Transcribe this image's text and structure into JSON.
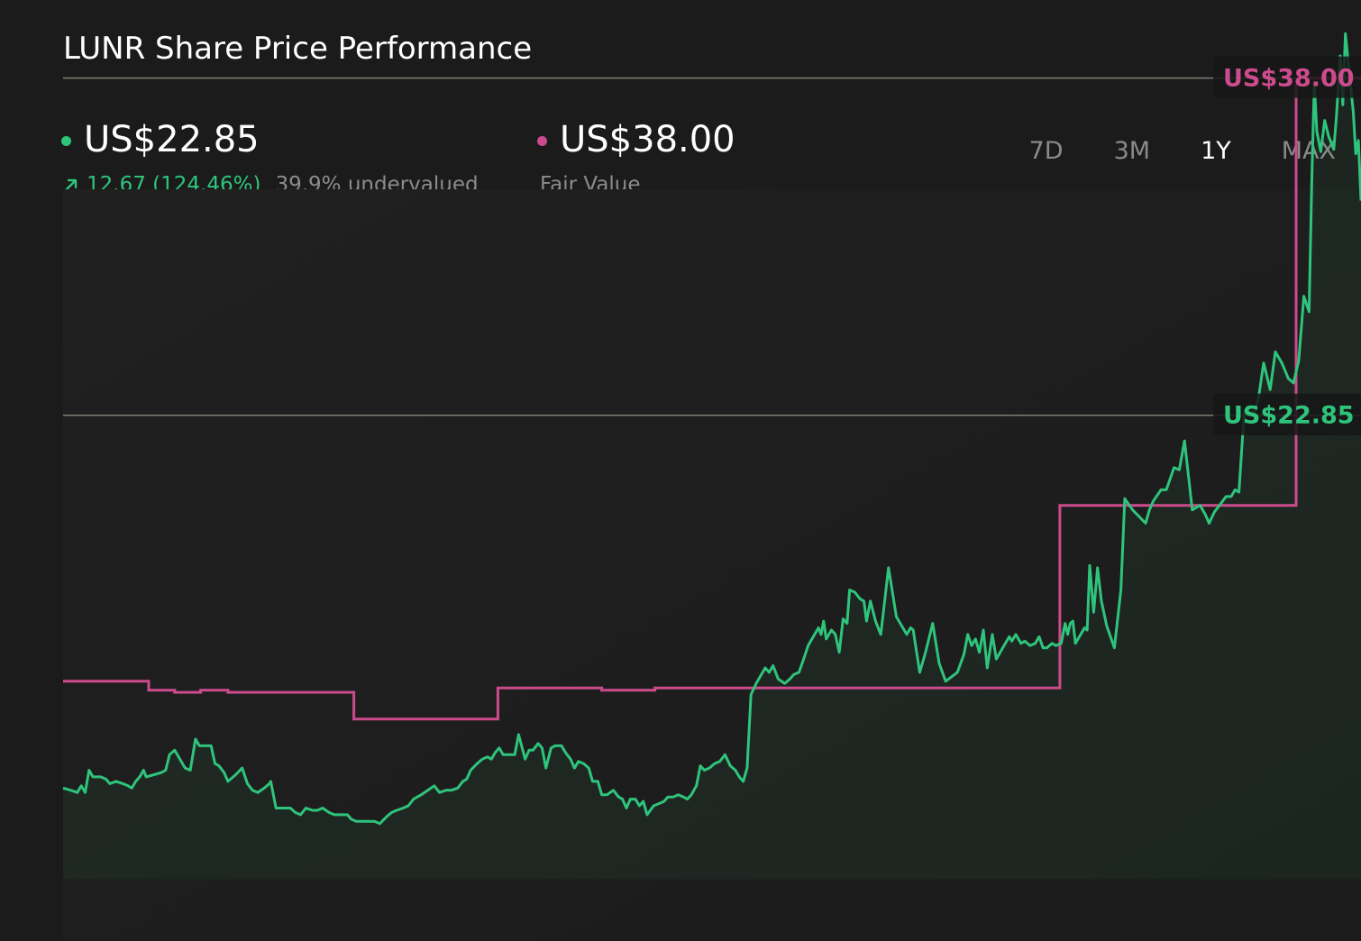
{
  "title": "LUNR Share Price Performance",
  "legend": {
    "price": {
      "value": "US$22.85",
      "color": "#2fc47c",
      "change": "12.67 (124.46%)",
      "note": "39.9% undervalued",
      "change_icon": "arrow-up-right-icon"
    },
    "fair": {
      "value": "US$38.00",
      "color": "#cc4b8c",
      "label": "Fair Value"
    }
  },
  "tabs": [
    {
      "label": "7D",
      "active": false
    },
    {
      "label": "3M",
      "active": false
    },
    {
      "label": "1Y",
      "active": true
    },
    {
      "label": "MAX",
      "active": false
    }
  ],
  "chart_data": {
    "type": "line",
    "ylim": [
      2,
      41
    ],
    "gridlines": [
      22.85,
      38.0
    ],
    "grid": true,
    "x_index_range": [
      0,
      1
    ],
    "series": [
      {
        "color": "#2fc47c",
        "area": true,
        "points": [
          [
            0.0,
            6.1
          ],
          [
            0.006,
            6.0
          ],
          [
            0.011,
            5.9
          ],
          [
            0.014,
            6.2
          ],
          [
            0.017,
            5.9
          ],
          [
            0.02,
            6.9
          ],
          [
            0.023,
            6.6
          ],
          [
            0.029,
            6.6
          ],
          [
            0.033,
            6.5
          ],
          [
            0.036,
            6.3
          ],
          [
            0.041,
            6.4
          ],
          [
            0.046,
            6.3
          ],
          [
            0.05,
            6.2
          ],
          [
            0.053,
            6.1
          ],
          [
            0.056,
            6.4
          ],
          [
            0.059,
            6.6
          ],
          [
            0.062,
            6.9
          ],
          [
            0.064,
            6.6
          ],
          [
            0.07,
            6.7
          ],
          [
            0.076,
            6.8
          ],
          [
            0.079,
            6.9
          ],
          [
            0.082,
            7.6
          ],
          [
            0.086,
            7.8
          ],
          [
            0.09,
            7.4
          ],
          [
            0.094,
            7.0
          ],
          [
            0.098,
            6.9
          ],
          [
            0.102,
            8.3
          ],
          [
            0.105,
            8.0
          ],
          [
            0.11,
            8.0
          ],
          [
            0.114,
            8.0
          ],
          [
            0.117,
            7.2
          ],
          [
            0.12,
            7.1
          ],
          [
            0.124,
            6.8
          ],
          [
            0.127,
            6.4
          ],
          [
            0.133,
            6.7
          ],
          [
            0.138,
            7.0
          ],
          [
            0.142,
            6.3
          ],
          [
            0.146,
            6.0
          ],
          [
            0.15,
            5.9
          ],
          [
            0.155,
            6.1
          ],
          [
            0.159,
            6.3
          ],
          [
            0.16,
            6.4
          ],
          [
            0.164,
            5.2
          ],
          [
            0.169,
            5.2
          ],
          [
            0.173,
            5.2
          ],
          [
            0.175,
            5.2
          ],
          [
            0.179,
            5.0
          ],
          [
            0.183,
            4.9
          ],
          [
            0.187,
            5.2
          ],
          [
            0.192,
            5.1
          ],
          [
            0.196,
            5.1
          ],
          [
            0.2,
            5.2
          ],
          [
            0.205,
            5.0
          ],
          [
            0.209,
            4.9
          ],
          [
            0.215,
            4.9
          ],
          [
            0.219,
            4.9
          ],
          [
            0.222,
            4.7
          ],
          [
            0.226,
            4.6
          ],
          [
            0.23,
            4.6
          ],
          [
            0.235,
            4.6
          ],
          [
            0.24,
            4.6
          ],
          [
            0.244,
            4.5
          ],
          [
            0.249,
            4.8
          ],
          [
            0.253,
            5.0
          ],
          [
            0.257,
            5.1
          ],
          [
            0.262,
            5.2
          ],
          [
            0.266,
            5.3
          ],
          [
            0.27,
            5.6
          ],
          [
            0.276,
            5.8
          ],
          [
            0.281,
            6.0
          ],
          [
            0.286,
            6.2
          ],
          [
            0.29,
            5.9
          ],
          [
            0.295,
            6.0
          ],
          [
            0.299,
            6.0
          ],
          [
            0.304,
            6.1
          ],
          [
            0.308,
            6.4
          ],
          [
            0.311,
            6.5
          ],
          [
            0.314,
            6.9
          ],
          [
            0.319,
            7.2
          ],
          [
            0.323,
            7.4
          ],
          [
            0.327,
            7.5
          ],
          [
            0.33,
            7.4
          ],
          [
            0.333,
            7.7
          ],
          [
            0.336,
            7.9
          ],
          [
            0.339,
            7.6
          ],
          [
            0.344,
            7.6
          ],
          [
            0.348,
            7.6
          ],
          [
            0.351,
            8.5
          ],
          [
            0.356,
            7.4
          ],
          [
            0.359,
            7.8
          ],
          [
            0.362,
            7.8
          ],
          [
            0.366,
            8.1
          ],
          [
            0.369,
            7.9
          ],
          [
            0.372,
            7.0
          ],
          [
            0.376,
            7.9
          ],
          [
            0.379,
            8.0
          ],
          [
            0.384,
            8.0
          ],
          [
            0.387,
            7.7
          ],
          [
            0.391,
            7.4
          ],
          [
            0.394,
            7.0
          ],
          [
            0.397,
            7.3
          ],
          [
            0.401,
            7.2
          ],
          [
            0.405,
            7.0
          ],
          [
            0.408,
            6.4
          ],
          [
            0.412,
            6.4
          ],
          [
            0.415,
            5.8
          ],
          [
            0.419,
            5.8
          ],
          [
            0.424,
            6.0
          ],
          [
            0.428,
            5.7
          ],
          [
            0.431,
            5.6
          ],
          [
            0.434,
            5.2
          ],
          [
            0.437,
            5.6
          ],
          [
            0.441,
            5.6
          ],
          [
            0.444,
            5.3
          ],
          [
            0.447,
            5.5
          ],
          [
            0.45,
            4.9
          ],
          [
            0.455,
            5.3
          ],
          [
            0.459,
            5.4
          ],
          [
            0.463,
            5.5
          ],
          [
            0.466,
            5.7
          ],
          [
            0.47,
            5.7
          ],
          [
            0.474,
            5.8
          ],
          [
            0.478,
            5.7
          ],
          [
            0.481,
            5.6
          ],
          [
            0.484,
            5.8
          ],
          [
            0.488,
            6.2
          ],
          [
            0.491,
            7.1
          ],
          [
            0.494,
            6.9
          ],
          [
            0.498,
            7.0
          ],
          [
            0.502,
            7.2
          ],
          [
            0.506,
            7.3
          ],
          [
            0.51,
            7.6
          ],
          [
            0.514,
            7.1
          ],
          [
            0.518,
            6.9
          ],
          [
            0.521,
            6.6
          ],
          [
            0.524,
            6.4
          ],
          [
            0.527,
            7.0
          ],
          [
            0.53,
            10.3
          ],
          [
            0.534,
            10.8
          ],
          [
            0.538,
            11.2
          ],
          [
            0.541,
            11.5
          ],
          [
            0.544,
            11.3
          ],
          [
            0.547,
            11.6
          ],
          [
            0.551,
            11.0
          ],
          [
            0.556,
            10.8
          ],
          [
            0.56,
            11.0
          ],
          [
            0.563,
            11.2
          ],
          [
            0.567,
            11.3
          ],
          [
            0.57,
            11.8
          ],
          [
            0.574,
            12.5
          ],
          [
            0.578,
            12.9
          ],
          [
            0.582,
            13.3
          ],
          [
            0.584,
            13.0
          ],
          [
            0.586,
            13.6
          ],
          [
            0.588,
            12.8
          ],
          [
            0.592,
            13.2
          ],
          [
            0.595,
            13.0
          ],
          [
            0.598,
            12.2
          ],
          [
            0.601,
            13.7
          ],
          [
            0.604,
            13.5
          ],
          [
            0.606,
            15.0
          ],
          [
            0.61,
            14.9
          ],
          [
            0.614,
            14.6
          ],
          [
            0.617,
            14.5
          ],
          [
            0.619,
            13.6
          ],
          [
            0.622,
            14.5
          ],
          [
            0.626,
            13.6
          ],
          [
            0.63,
            13.0
          ],
          [
            0.636,
            16.0
          ],
          [
            0.642,
            13.8
          ],
          [
            0.65,
            13.0
          ],
          [
            0.653,
            13.3
          ],
          [
            0.655,
            13.2
          ],
          [
            0.66,
            11.3
          ],
          [
            0.664,
            12.1
          ],
          [
            0.67,
            13.5
          ],
          [
            0.675,
            11.7
          ],
          [
            0.68,
            10.9
          ],
          [
            0.689,
            11.3
          ],
          [
            0.694,
            12.1
          ],
          [
            0.697,
            13.0
          ],
          [
            0.7,
            12.5
          ],
          [
            0.703,
            12.8
          ],
          [
            0.706,
            12.2
          ],
          [
            0.709,
            13.2
          ],
          [
            0.712,
            11.5
          ],
          [
            0.716,
            13.0
          ],
          [
            0.719,
            11.9
          ],
          [
            0.723,
            12.3
          ],
          [
            0.726,
            12.6
          ],
          [
            0.729,
            12.9
          ],
          [
            0.731,
            12.7
          ],
          [
            0.734,
            13.0
          ],
          [
            0.738,
            12.6
          ],
          [
            0.741,
            12.7
          ],
          [
            0.745,
            12.5
          ],
          [
            0.749,
            12.6
          ],
          [
            0.752,
            12.9
          ],
          [
            0.755,
            12.4
          ],
          [
            0.758,
            12.4
          ],
          [
            0.762,
            12.6
          ],
          [
            0.765,
            12.5
          ],
          [
            0.769,
            12.6
          ],
          [
            0.772,
            13.5
          ],
          [
            0.774,
            13.0
          ],
          [
            0.776,
            13.5
          ],
          [
            0.778,
            13.6
          ],
          [
            0.78,
            12.6
          ],
          [
            0.784,
            13.0
          ],
          [
            0.787,
            13.3
          ],
          [
            0.789,
            13.2
          ],
          [
            0.791,
            16.1
          ],
          [
            0.794,
            14.0
          ],
          [
            0.797,
            16.0
          ],
          [
            0.8,
            14.5
          ],
          [
            0.804,
            13.4
          ],
          [
            0.81,
            12.4
          ],
          [
            0.815,
            15.0
          ],
          [
            0.818,
            19.1
          ],
          [
            0.824,
            18.6
          ],
          [
            0.829,
            18.3
          ],
          [
            0.834,
            18.0
          ],
          [
            0.837,
            18.6
          ],
          [
            0.84,
            19.0
          ],
          [
            0.846,
            19.5
          ],
          [
            0.85,
            19.5
          ],
          [
            0.856,
            20.5
          ],
          [
            0.86,
            20.4
          ],
          [
            0.864,
            21.7
          ],
          [
            0.87,
            18.6
          ],
          [
            0.876,
            18.8
          ],
          [
            0.88,
            18.4
          ],
          [
            0.883,
            18.0
          ],
          [
            0.887,
            18.5
          ],
          [
            0.891,
            18.8
          ],
          [
            0.896,
            19.2
          ],
          [
            0.9,
            19.2
          ],
          [
            0.903,
            19.5
          ],
          [
            0.906,
            19.4
          ],
          [
            0.91,
            23.0
          ],
          [
            0.914,
            23.0
          ],
          [
            0.918,
            23.0
          ],
          [
            0.921,
            23.6
          ],
          [
            0.925,
            25.2
          ],
          [
            0.93,
            24.0
          ],
          [
            0.934,
            25.7
          ],
          [
            0.939,
            25.2
          ],
          [
            0.944,
            24.5
          ],
          [
            0.948,
            24.3
          ],
          [
            0.952,
            25.3
          ],
          [
            0.956,
            28.2
          ],
          [
            0.96,
            27.5
          ],
          [
            0.962,
            33.2
          ],
          [
            0.964,
            37.8
          ],
          [
            0.966,
            35.6
          ],
          [
            0.969,
            34.7
          ],
          [
            0.972,
            36.1
          ],
          [
            0.975,
            35.4
          ],
          [
            0.979,
            34.8
          ],
          [
            0.981,
            36.2
          ],
          [
            0.984,
            39.0
          ],
          [
            0.986,
            36.8
          ],
          [
            0.988,
            40.0
          ],
          [
            0.991,
            38.2
          ],
          [
            0.994,
            36.5
          ],
          [
            0.996,
            34.6
          ],
          [
            0.998,
            35.2
          ],
          [
            1.0,
            32.5
          ]
        ]
      },
      {
        "color": "#cc4b8c",
        "step": true,
        "points": [
          [
            0.0,
            10.9
          ],
          [
            0.066,
            10.9
          ],
          [
            0.066,
            10.5
          ],
          [
            0.086,
            10.5
          ],
          [
            0.086,
            10.4
          ],
          [
            0.106,
            10.4
          ],
          [
            0.106,
            10.5
          ],
          [
            0.127,
            10.5
          ],
          [
            0.127,
            10.4
          ],
          [
            0.224,
            10.4
          ],
          [
            0.224,
            9.2
          ],
          [
            0.335,
            9.2
          ],
          [
            0.335,
            10.6
          ],
          [
            0.415,
            10.6
          ],
          [
            0.415,
            10.5
          ],
          [
            0.456,
            10.5
          ],
          [
            0.456,
            10.6
          ],
          [
            0.768,
            10.6
          ],
          [
            0.768,
            18.8
          ],
          [
            0.95,
            18.8
          ],
          [
            0.95,
            38.0
          ],
          [
            1.0,
            38.0
          ]
        ]
      }
    ],
    "tags": [
      {
        "label": "US$38.00",
        "value": 38.0,
        "color": "#cc4b8c"
      },
      {
        "label": "US$22.85",
        "value": 22.85,
        "color": "#2fc47c"
      }
    ]
  }
}
